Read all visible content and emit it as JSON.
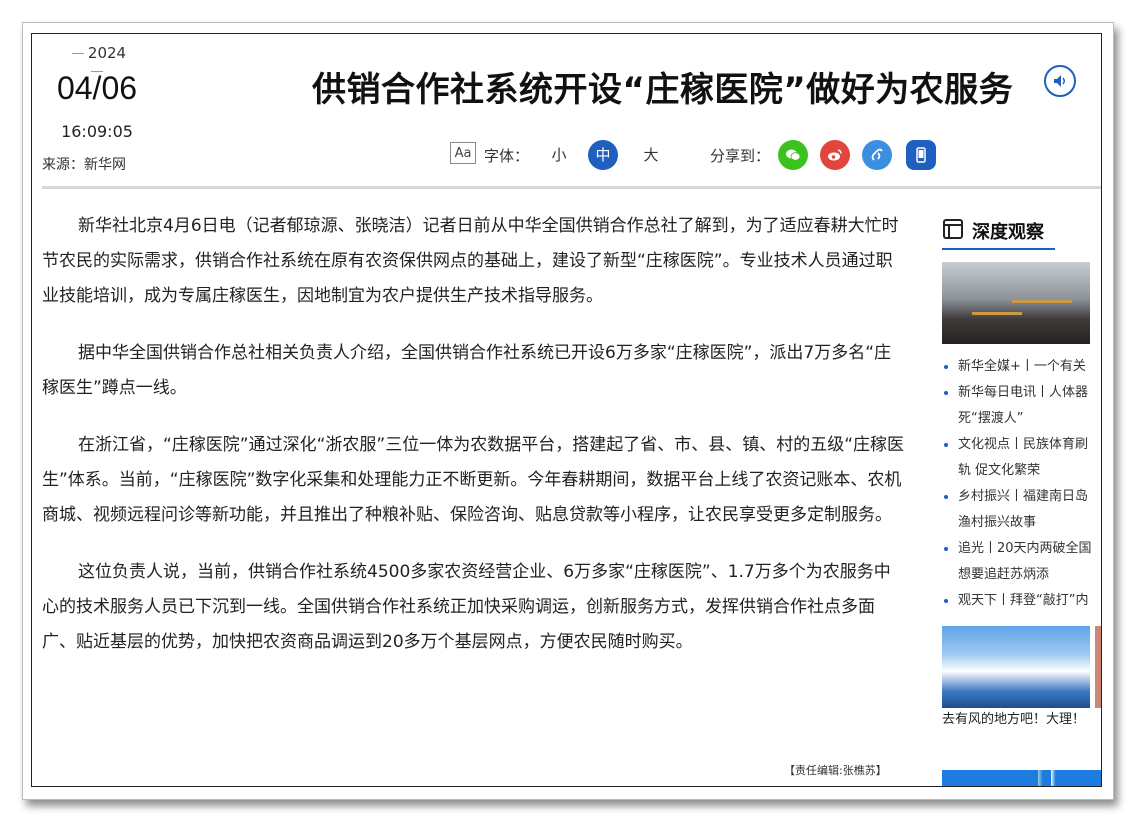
{
  "header": {
    "year": "2024",
    "date": "04/06",
    "time": "16:09:05",
    "source": "来源：新华网",
    "title": "供销合作社系统开设“庄稼医院”做好为农服务"
  },
  "toolbar": {
    "font_label": "字体：",
    "font_icon_text": "Aa",
    "size_small": "小",
    "size_medium": "中",
    "size_large": "大",
    "share_label": "分享到："
  },
  "article": {
    "paragraphs": [
      "新华社北京4月6日电（记者郁琼源、张晓洁）记者日前从中华全国供销合作总社了解到，为了适应春耕大忙时节农民的实际需求，供销合作社系统在原有农资保供网点的基础上，建设了新型“庄稼医院”。专业技术人员通过职业技能培训，成为专属庄稼医生，因地制宜为农户提供生产技术指导服务。",
      "据中华全国供销合作总社相关负责人介绍，全国供销合作社系统已开设6万多家“庄稼医院”，派出7万多名“庄稼医生”蹲点一线。",
      "在浙江省，“庄稼医院”通过深化“浙农服”三位一体为农数据平台，搭建起了省、市、县、镇、村的五级“庄稼医生”体系。当前，“庄稼医院”数字化采集和处理能力正不断更新。今年春耕期间，数据平台上线了农资记账本、农机商城、视频远程问诊等新功能，并且推出了种粮补贴、保险咨询、贴息贷款等小程序，让农民享受更多定制服务。",
      "这位负责人说，当前，供销合作社系统4500多家农资经营企业、6万多家“庄稼医院”、1.7万多个为农服务中心的技术服务人员已下沉到一线。全国供销合作社系统正加快采购调运，创新服务方式，发挥供销合作社点多面广、贴近基层的优势，加快把农资商品调运到20多万个基层网点，方便农民随时购买。"
    ],
    "editor": "【责任编辑:张樵苏】"
  },
  "sidebar": {
    "title": "深度观察",
    "items": [
      "新华全媒+丨一个有关",
      "新华每日电讯丨人体器",
      "死“摆渡人”",
      "文化视点丨民族体育刷",
      "轨 促文化繁荣",
      "乡村振兴丨福建南日岛",
      "渔村振兴故事",
      "追光丨20天内两破全国",
      "想要追赶苏炳添",
      "观天下丨拜登“敲打”内"
    ],
    "bullets": [
      true,
      true,
      false,
      true,
      false,
      true,
      false,
      true,
      false,
      true
    ],
    "caption": "去有风的地方吧！大理！"
  },
  "colors": {
    "accent": "#1e5fbf",
    "wechat": "#3cc21e",
    "weibo": "#e2453c",
    "link": "#3b8fe0"
  },
  "icons": {
    "audio": "speaker-icon",
    "font": "font-size-icon",
    "share": [
      "wechat-icon",
      "weibo-icon",
      "link-icon",
      "mobile-icon"
    ]
  }
}
